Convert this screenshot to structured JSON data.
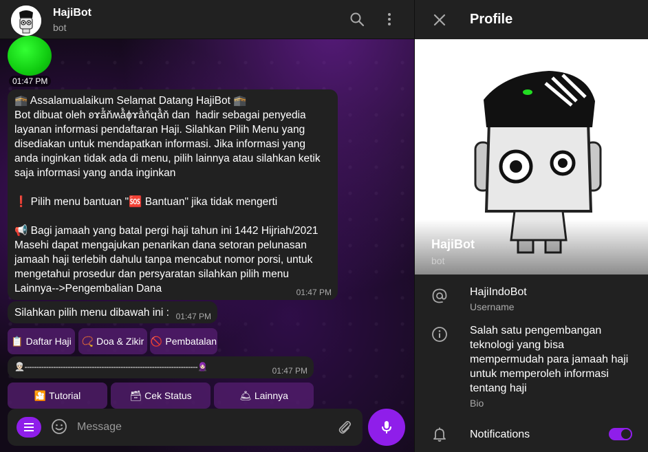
{
  "chat": {
    "title": "HajiBot",
    "subtitle": "bot",
    "sticker_time": "01:47 PM",
    "messages": [
      {
        "text": "🕋 Assalamualaikum Selamat Datang HajiBot 🕋\nBot dibuat oleh ʚɤã̊ňʍå̊ɸɤâ̊ňզå̊ň dan  hadir sebagai penyedia layanan informasi pendaftaran Haji. Silahkan Pilih Menu yang disediakan untuk mendapatkan informasi. Jika informasi yang anda inginkan tidak ada di menu, pilih lainnya atau silahkan ketik saja informasi yang anda inginkan\n\n❗ Pilih menu bantuan \"🆘 Bantuan\" jika tidak mengerti\n\n📢 Bagi jamaah yang batal pergi haji tahun ini 1442 Hijriah/2021 Masehi dapat mengajukan penarikan dana setoran pelunasan jamaah haji terlebih dahulu tanpa mencabut nomor porsi, untuk mengetahui prosedur dan persyaratan silahkan pilih menu Lainnya-->Pengembalian Dana",
        "time": "01:47 PM"
      },
      {
        "text": "Silahkan pilih menu dibawah ini :",
        "time": "01:47 PM"
      },
      {
        "text": "👳🏻‍♂️------------------------------------------------------------------------🧕🏻",
        "time": "01:47 PM"
      }
    ],
    "inline_buttons": [
      {
        "emoji": "📋",
        "label": "Daftar Haji"
      },
      {
        "emoji": "📿",
        "label": "Doa & Zikir"
      },
      {
        "emoji": "🚫",
        "label": "Pembatalan"
      }
    ],
    "keyboard_buttons": [
      {
        "emoji": "🎦",
        "label": "Tutorial"
      },
      {
        "emoji": "🗃",
        "label": "Cek Status"
      },
      {
        "emoji": "🛎",
        "label": "Lainnya"
      }
    ],
    "composer_placeholder": "Message"
  },
  "profile": {
    "title": "Profile",
    "name": "HajiBot",
    "subtitle": "bot",
    "username": "HajiIndoBot",
    "username_label": "Username",
    "bio": "Salah satu pengembangan teknologi yang bisa mempermudah para jamaah haji untuk memperoleh informasi tentang haji",
    "bio_label": "Bio",
    "notifications_label": "Notifications",
    "notifications_on": true
  },
  "colors": {
    "accent": "#8f1eea",
    "panel": "#212121",
    "secondary_text": "#aaaaaa"
  },
  "icons": [
    "search-icon",
    "more-vertical-icon",
    "menu-icon",
    "emoji-icon",
    "paperclip-icon",
    "microphone-icon",
    "close-icon",
    "at-sign-icon",
    "info-icon",
    "bell-icon"
  ]
}
